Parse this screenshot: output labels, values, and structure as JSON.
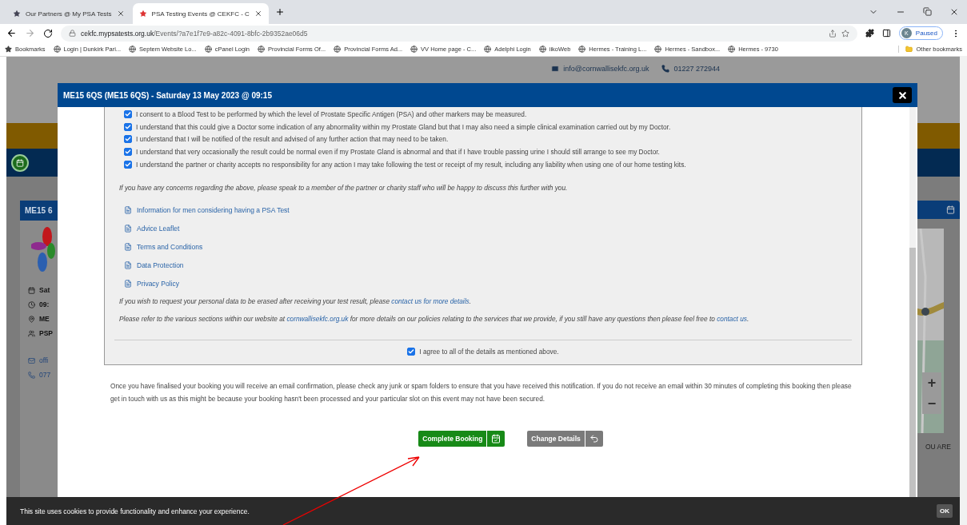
{
  "browser": {
    "tabs": [
      {
        "title": "Our Partners @ My PSA Tests",
        "selected": false
      },
      {
        "title": "PSA Testing Events @ CEKFC - C",
        "selected": true
      }
    ],
    "address": {
      "domain": "cekfc.mypsatests.org.uk",
      "path": "/Events/?a7e1f7e9-a82c-4091-8bfc-2b9352ae06d5"
    },
    "profile": {
      "initial": "K",
      "status": "Paused"
    },
    "bookmarks": [
      "Bookmarks",
      "Login | Dunkirk Pari...",
      "Septem Website Lo...",
      "cPanel Login",
      "Provincial Forms Of...",
      "Provincial Forms Ad...",
      "VV Home page - C...",
      "Adelphi Login",
      "iikoWeb",
      "Hermes - Training L...",
      "Hermes - Sandbox...",
      "Hermes - 9730"
    ],
    "other_bookmarks": "Other bookmarks"
  },
  "page": {
    "contact": {
      "email": "info@cornwallisekfc.org.uk",
      "phone": "01227 272944"
    },
    "event_card": {
      "title": "ME15 6",
      "details": [
        "Sat",
        "09:",
        "ME",
        "PSP"
      ],
      "contact": [
        "offi",
        "077"
      ]
    },
    "side_text": "OU ARE",
    "map_controls": [
      "+",
      "−"
    ]
  },
  "modal": {
    "title": "ME15 6QS (ME15 6QS) - Saturday 13 May 2023 @ 09:15",
    "consents": [
      {
        "text": "I consent to a Blood Test to be performed by which the level of Prostate Specific Antigen (PSA) and other markers may be measured.",
        "checked": true
      },
      {
        "text": "I understand that this could give a Doctor some indication of any abnormality within my Prostate Gland but that I may also need a simple clinical examination carried out by my Doctor.",
        "checked": true
      },
      {
        "text": "I understand that I will be notified of the result and advised of any further action that may need to be taken.",
        "checked": true
      },
      {
        "text": "I understand that very occasionally the result could be normal even if my Prostate Gland is abnormal and that if I have trouble passing urine I should still arrange to see my Doctor.",
        "checked": true
      },
      {
        "text": "I understand the partner or charity accepts no responsibility for any action I may take following the test or receipt of my result, including any liability when using one of our home testing kits.",
        "checked": true
      }
    ],
    "concerns_note": "If you have any concerns regarding the above, please speak to a member of the partner or charity staff who will be happy to discuss this further with you.",
    "documents": [
      "Information for men considering having a PSA Test",
      "Advice Leaflet",
      "Terms and Conditions",
      "Data Protection",
      "Privacy Policy"
    ],
    "notes": [
      [
        {
          "kind": "text",
          "text": "If you wish to request your personal data to be erased after receiving your test result, please "
        },
        {
          "kind": "link",
          "text": "contact us for more details"
        },
        {
          "kind": "text",
          "text": "."
        }
      ],
      [
        {
          "kind": "text",
          "text": "Please refer to the various sections within our website at "
        },
        {
          "kind": "link",
          "text": "cornwallisekfc.org.uk"
        },
        {
          "kind": "text",
          "text": " for more details on our policies relating to the services that we provide, if you still have any questions then please feel free to "
        },
        {
          "kind": "link",
          "text": "contact us"
        },
        {
          "kind": "text",
          "text": "."
        }
      ]
    ],
    "agree": {
      "label": "I agree to all of the details as mentioned above.",
      "checked": true
    },
    "confirmation_text": "Once you have finalised your booking you will receive an email confirmation, please check any junk or spam folders to ensure that you have received this notification. If you do not receive an email within 30 minutes of completing this booking then please get in touch with us as this might be because your booking hasn't been processed and your particular slot on this event may not have been secured.",
    "buttons": [
      {
        "label": "Complete Booking",
        "kind": "primary"
      },
      {
        "label": "Change Details",
        "kind": "secondary"
      }
    ]
  },
  "cookie_bar": {
    "text": "This site uses cookies to provide functionality and enhance your experience.",
    "button": "OK"
  }
}
